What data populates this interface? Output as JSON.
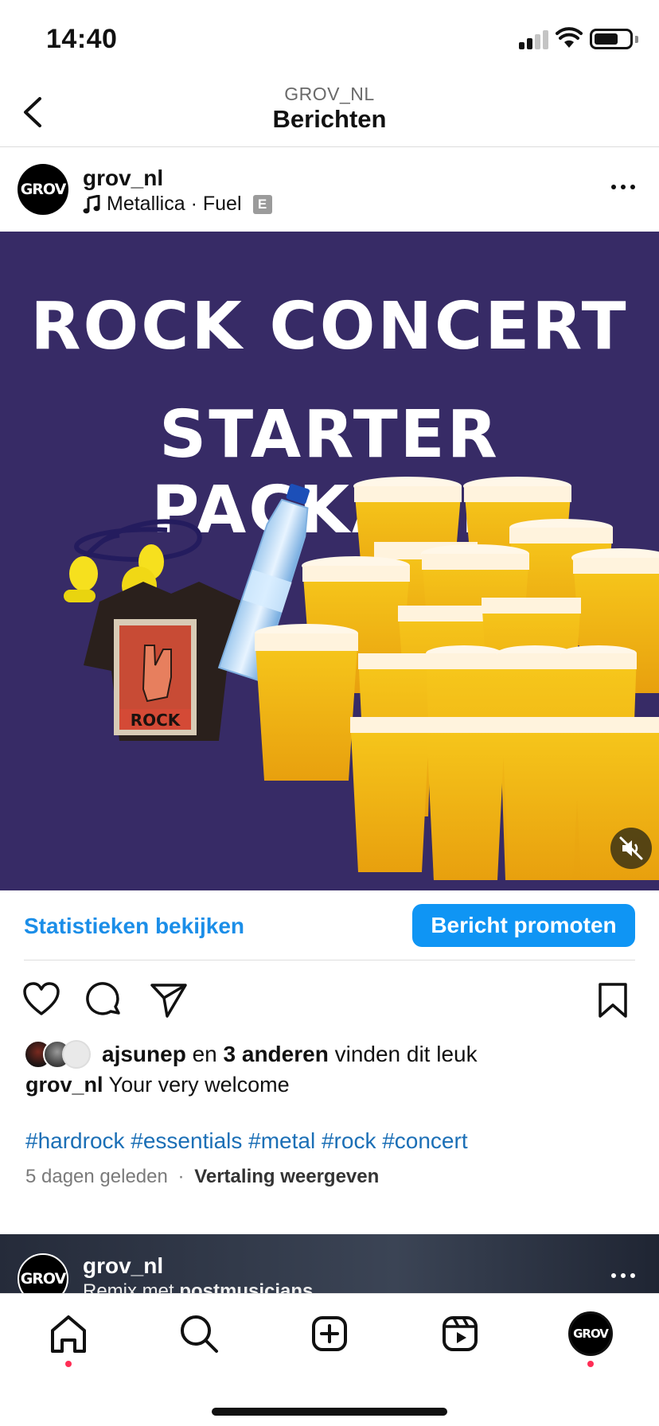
{
  "status": {
    "time": "14:40",
    "battery_level": 0.7
  },
  "header": {
    "account": "GROV_NL",
    "title": "Berichten"
  },
  "post": {
    "avatar_text": "GROV",
    "username": "grov_nl",
    "song": "Metallica · Fuel",
    "explicit_badge": "E",
    "media": {
      "line1": "ROCK CONCERT",
      "line2": "STARTER PACKAGE",
      "shirt_text": "ROCK",
      "background_color": "#372b66"
    },
    "promo": {
      "stats_link": "Statistieken bekijken",
      "promote_button": "Bericht promoten"
    },
    "likes": {
      "user": "ajsunep",
      "joiner": "en",
      "others": "3 anderen",
      "suffix": "vinden dit leuk"
    },
    "caption": {
      "user": "grov_nl",
      "text": "Your very welcome"
    },
    "hashtags": "#hardrock #essentials #metal #rock #concert",
    "time_ago": "5 dagen geleden",
    "separator": "·",
    "translate": "Vertaling weergeven"
  },
  "next_post": {
    "avatar_text": "GROV",
    "username": "grov_nl",
    "subtitle_prefix": "Remix met",
    "subtitle_user": "postmusicians"
  },
  "tabbar": {
    "profile_avatar_text": "GROV"
  }
}
